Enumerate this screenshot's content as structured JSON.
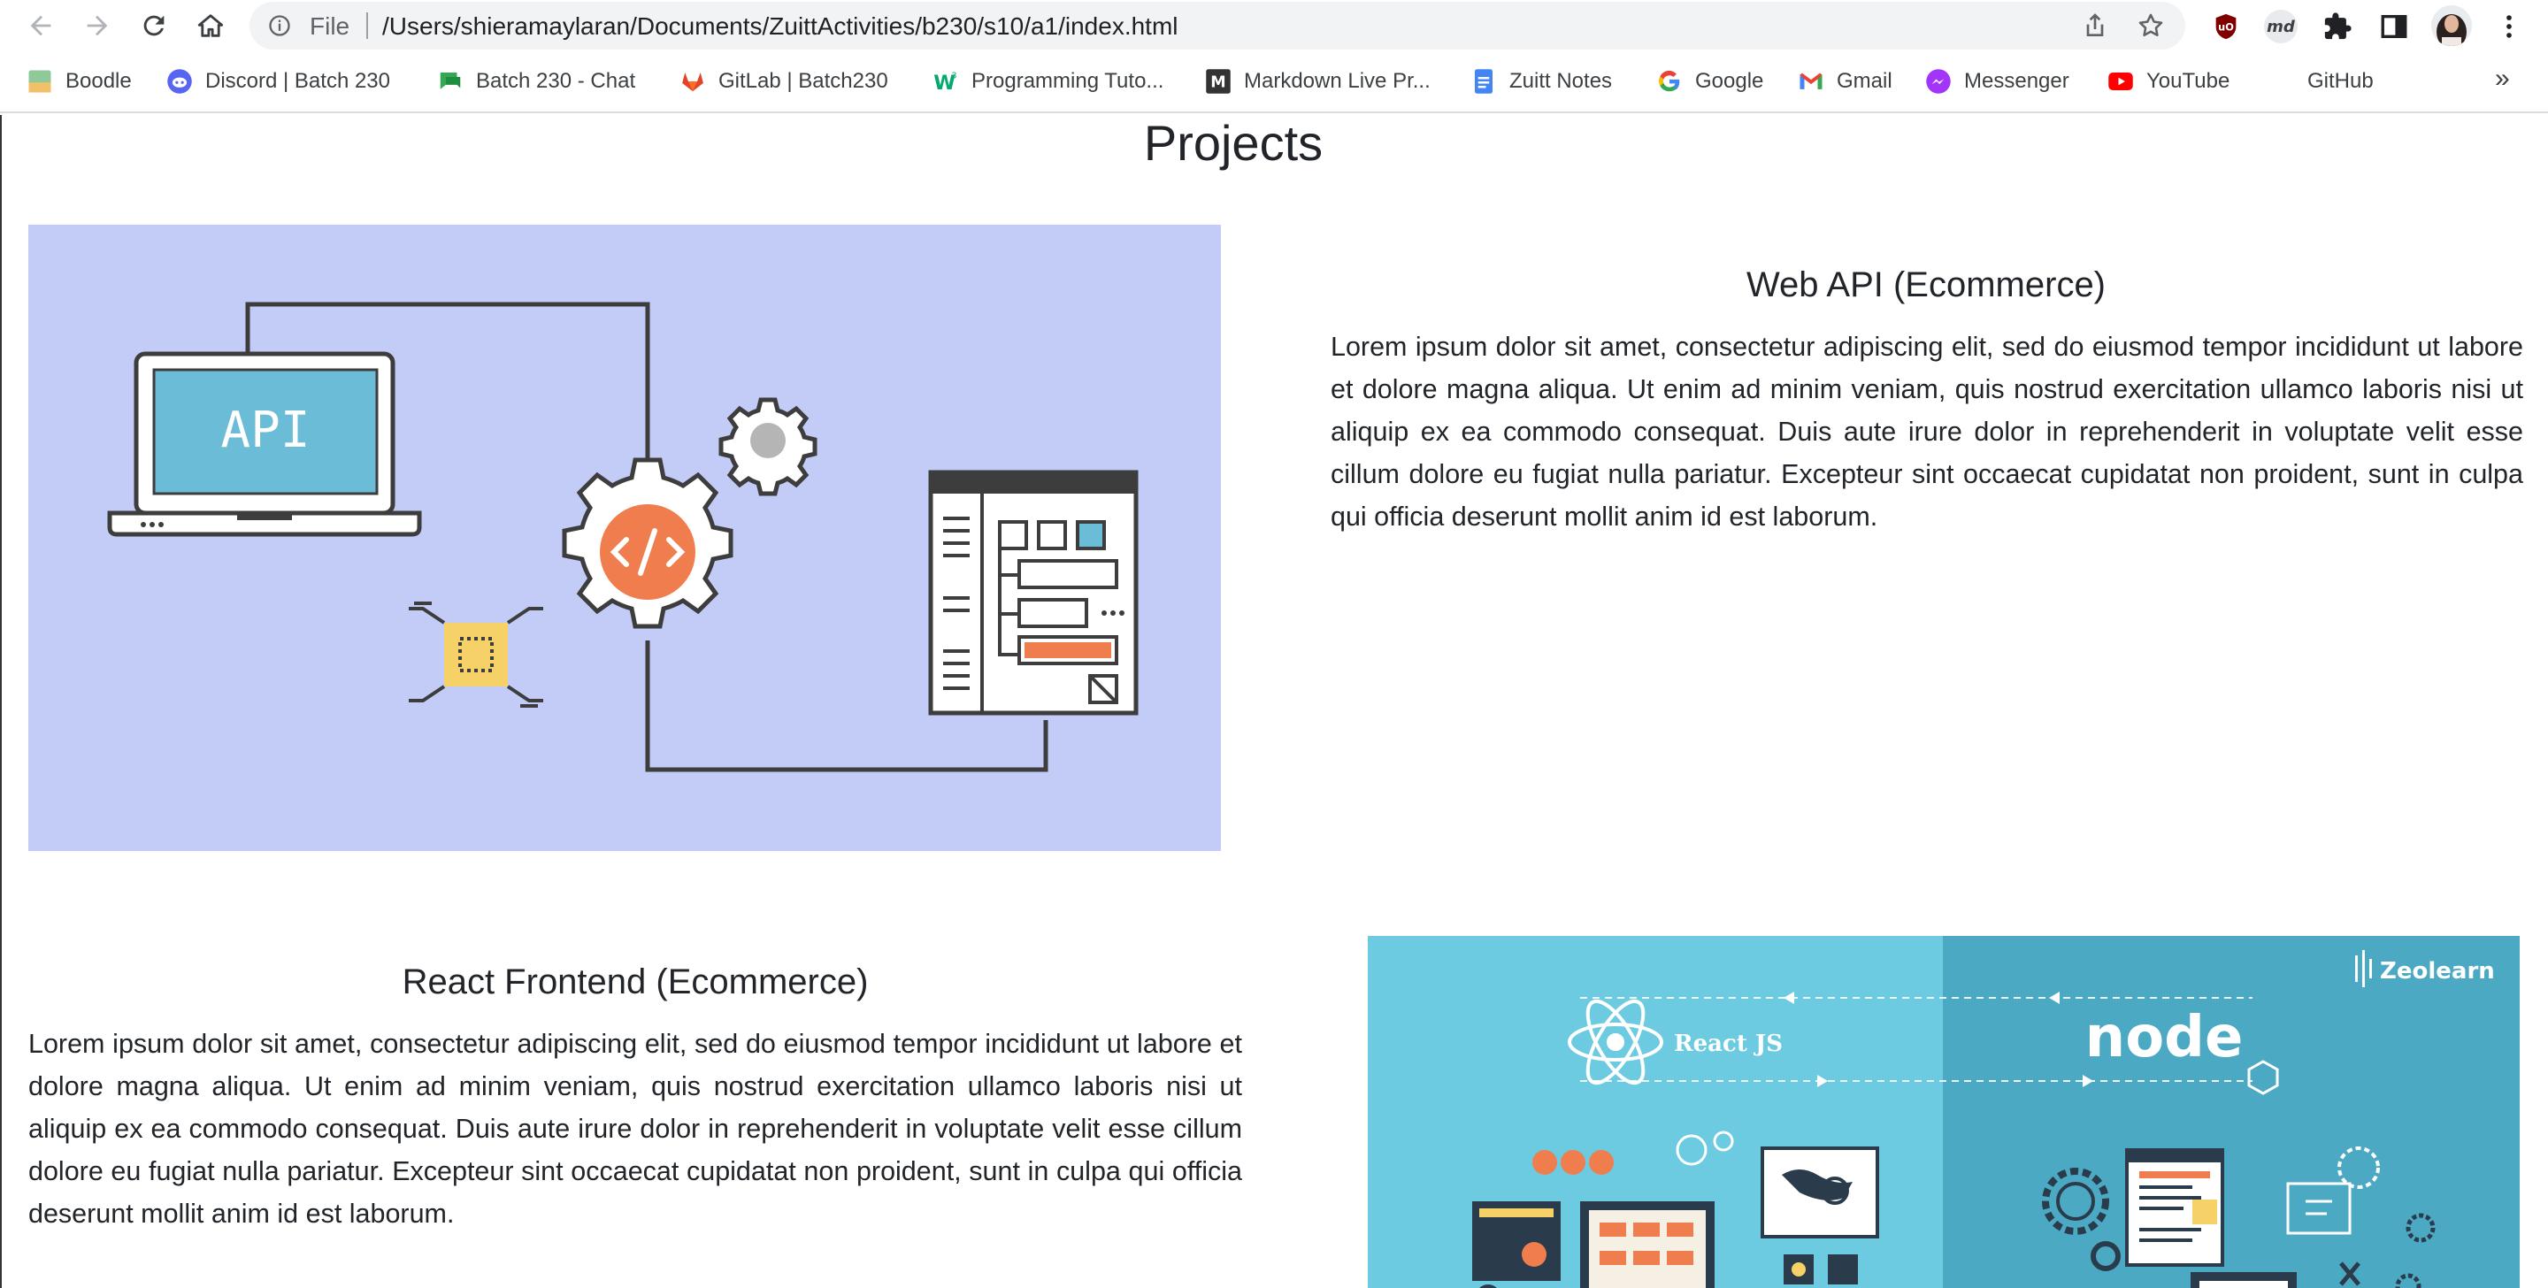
{
  "browser": {
    "address_label": "File",
    "url": "/Users/shieramaylaran/Documents/ZuittActivities/b230/s10/a1/index.html",
    "bookmarks": [
      {
        "label": "Boodle",
        "icon": "boodle-icon"
      },
      {
        "label": "Discord | Batch 230",
        "icon": "discord-icon"
      },
      {
        "label": "Batch 230 - Chat",
        "icon": "chat-icon"
      },
      {
        "label": "GitLab | Batch230",
        "icon": "gitlab-icon"
      },
      {
        "label": "Programming Tuto...",
        "icon": "w3schools-icon"
      },
      {
        "label": "Markdown Live Pr...",
        "icon": "markdown-icon"
      },
      {
        "label": "Zuitt Notes",
        "icon": "docs-icon"
      },
      {
        "label": "Google",
        "icon": "google-icon"
      },
      {
        "label": "Gmail",
        "icon": "gmail-icon"
      },
      {
        "label": "Messenger",
        "icon": "messenger-icon"
      },
      {
        "label": "YouTube",
        "icon": "youtube-icon"
      },
      {
        "label": "GitHub",
        "icon": "github-icon"
      }
    ],
    "more_bookmarks": "»",
    "extensions": {
      "md_label": "md"
    }
  },
  "page": {
    "title": "Projects",
    "projects": [
      {
        "title": "Web API (Ecommerce)",
        "description": "Lorem ipsum dolor sit amet, consectetur adipiscing elit, sed do eiusmod tempor incididunt ut labore et dolore magna aliqua. Ut enim ad minim veniam, quis nostrud exercitation ullamco laboris nisi ut aliquip ex ea commodo consequat. Duis aute irure dolor in reprehenderit in voluptate velit esse cillum dolore eu fugiat nulla pariatur. Excepteur sint occaecat cupidatat non proident, sunt in culpa qui officia deserunt mollit anim id est laborum.",
        "image_text": "API"
      },
      {
        "title": "React Frontend (Ecommerce)",
        "description": "Lorem ipsum dolor sit amet, consectetur adipiscing elit, sed do eiusmod tempor incididunt ut labore et dolore magna aliqua. Ut enim ad minim veniam, quis nostrud exercitation ullamco laboris nisi ut aliquip ex ea commodo consequat. Duis aute irure dolor in reprehenderit in voluptate velit esse cillum dolore eu fugiat nulla pariatur. Excepteur sint occaecat cupidatat non proident, sunt in culpa qui officia deserunt mollit anim id est laborum.",
        "image_texts": {
          "react": "React JS",
          "node": "node",
          "brand": "Zeolearn"
        }
      }
    ]
  },
  "colors": {
    "accent_orange": "#ef7d4e",
    "api_bg": "#c3ccf7",
    "react_bg": "#6ccbe0",
    "node_bg": "#4ba9c4"
  }
}
